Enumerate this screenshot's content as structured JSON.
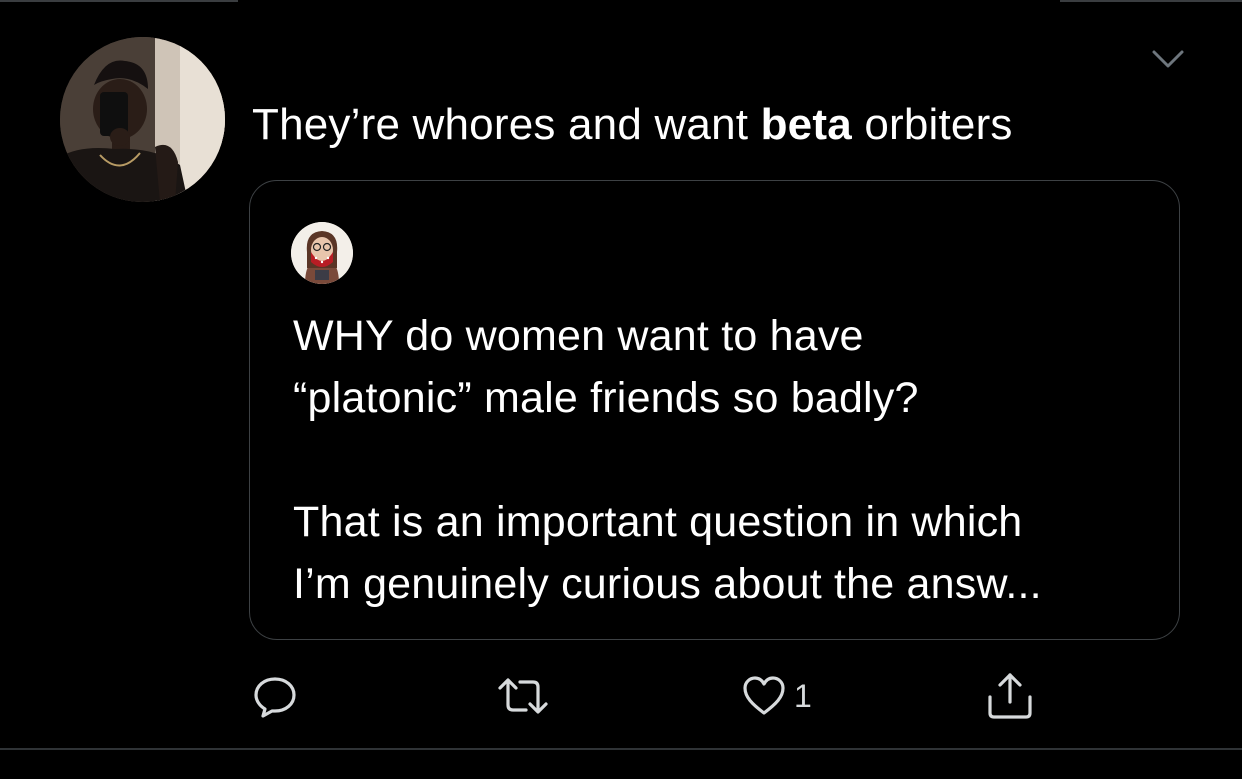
{
  "tweet": {
    "text_before": "They’re whores and want ",
    "text_bold": "beta",
    "text_after": " orbiters",
    "menu_icon": "chevron-down-icon"
  },
  "quoted_tweet": {
    "line1": "WHY do women want to have",
    "line2": "“platonic” male friends so badly?",
    "line3": "That is an important question in which",
    "line4": "I’m genuinely curious about the answ..."
  },
  "actions": {
    "reply_icon": "reply-icon",
    "retweet_icon": "retweet-icon",
    "like_icon": "heart-icon",
    "like_count": "1",
    "share_icon": "share-icon"
  },
  "colors": {
    "background": "#000000",
    "text": "#ffffff",
    "border": "#3d4144",
    "icon": "#d7dadc"
  }
}
